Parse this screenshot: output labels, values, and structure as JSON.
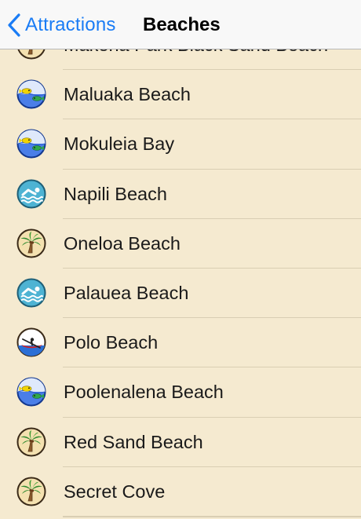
{
  "nav": {
    "back_label": "Attractions",
    "title": "Beaches"
  },
  "beaches": [
    {
      "name": "Makena Park Black Sand Beach",
      "icon": "palm-tree-icon"
    },
    {
      "name": "Maluaka Beach",
      "icon": "snorkel-fish-icon"
    },
    {
      "name": "Mokuleia Bay",
      "icon": "snorkel-fish-icon"
    },
    {
      "name": "Napili Beach",
      "icon": "swimmer-icon"
    },
    {
      "name": "Oneloa Beach",
      "icon": "palm-tree-icon"
    },
    {
      "name": "Palauea Beach",
      "icon": "swimmer-icon"
    },
    {
      "name": "Polo Beach",
      "icon": "kayak-icon"
    },
    {
      "name": "Poolenalena Beach",
      "icon": "snorkel-fish-icon"
    },
    {
      "name": "Red Sand Beach",
      "icon": "palm-tree-icon"
    },
    {
      "name": "Secret Cove",
      "icon": "palm-tree-icon"
    }
  ],
  "colors": {
    "background": "#f5ead0",
    "accent": "#1a7cf5",
    "separator": "#d9ceb3"
  }
}
